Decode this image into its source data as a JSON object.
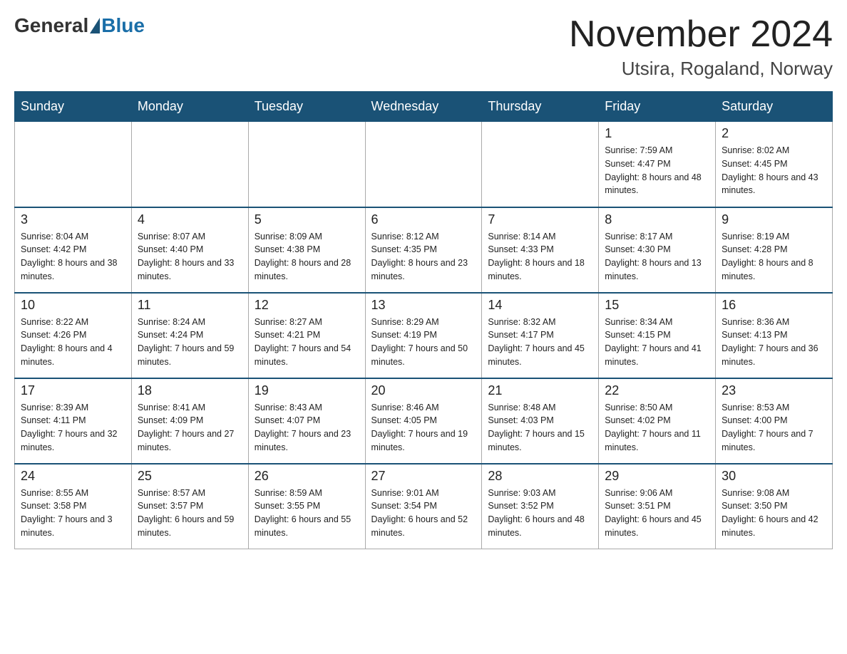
{
  "header": {
    "logo_general": "General",
    "logo_blue": "Blue",
    "month_title": "November 2024",
    "location": "Utsira, Rogaland, Norway"
  },
  "days_of_week": [
    "Sunday",
    "Monday",
    "Tuesday",
    "Wednesday",
    "Thursday",
    "Friday",
    "Saturday"
  ],
  "weeks": [
    [
      {
        "day": "",
        "info": ""
      },
      {
        "day": "",
        "info": ""
      },
      {
        "day": "",
        "info": ""
      },
      {
        "day": "",
        "info": ""
      },
      {
        "day": "",
        "info": ""
      },
      {
        "day": "1",
        "info": "Sunrise: 7:59 AM\nSunset: 4:47 PM\nDaylight: 8 hours and 48 minutes."
      },
      {
        "day": "2",
        "info": "Sunrise: 8:02 AM\nSunset: 4:45 PM\nDaylight: 8 hours and 43 minutes."
      }
    ],
    [
      {
        "day": "3",
        "info": "Sunrise: 8:04 AM\nSunset: 4:42 PM\nDaylight: 8 hours and 38 minutes."
      },
      {
        "day": "4",
        "info": "Sunrise: 8:07 AM\nSunset: 4:40 PM\nDaylight: 8 hours and 33 minutes."
      },
      {
        "day": "5",
        "info": "Sunrise: 8:09 AM\nSunset: 4:38 PM\nDaylight: 8 hours and 28 minutes."
      },
      {
        "day": "6",
        "info": "Sunrise: 8:12 AM\nSunset: 4:35 PM\nDaylight: 8 hours and 23 minutes."
      },
      {
        "day": "7",
        "info": "Sunrise: 8:14 AM\nSunset: 4:33 PM\nDaylight: 8 hours and 18 minutes."
      },
      {
        "day": "8",
        "info": "Sunrise: 8:17 AM\nSunset: 4:30 PM\nDaylight: 8 hours and 13 minutes."
      },
      {
        "day": "9",
        "info": "Sunrise: 8:19 AM\nSunset: 4:28 PM\nDaylight: 8 hours and 8 minutes."
      }
    ],
    [
      {
        "day": "10",
        "info": "Sunrise: 8:22 AM\nSunset: 4:26 PM\nDaylight: 8 hours and 4 minutes."
      },
      {
        "day": "11",
        "info": "Sunrise: 8:24 AM\nSunset: 4:24 PM\nDaylight: 7 hours and 59 minutes."
      },
      {
        "day": "12",
        "info": "Sunrise: 8:27 AM\nSunset: 4:21 PM\nDaylight: 7 hours and 54 minutes."
      },
      {
        "day": "13",
        "info": "Sunrise: 8:29 AM\nSunset: 4:19 PM\nDaylight: 7 hours and 50 minutes."
      },
      {
        "day": "14",
        "info": "Sunrise: 8:32 AM\nSunset: 4:17 PM\nDaylight: 7 hours and 45 minutes."
      },
      {
        "day": "15",
        "info": "Sunrise: 8:34 AM\nSunset: 4:15 PM\nDaylight: 7 hours and 41 minutes."
      },
      {
        "day": "16",
        "info": "Sunrise: 8:36 AM\nSunset: 4:13 PM\nDaylight: 7 hours and 36 minutes."
      }
    ],
    [
      {
        "day": "17",
        "info": "Sunrise: 8:39 AM\nSunset: 4:11 PM\nDaylight: 7 hours and 32 minutes."
      },
      {
        "day": "18",
        "info": "Sunrise: 8:41 AM\nSunset: 4:09 PM\nDaylight: 7 hours and 27 minutes."
      },
      {
        "day": "19",
        "info": "Sunrise: 8:43 AM\nSunset: 4:07 PM\nDaylight: 7 hours and 23 minutes."
      },
      {
        "day": "20",
        "info": "Sunrise: 8:46 AM\nSunset: 4:05 PM\nDaylight: 7 hours and 19 minutes."
      },
      {
        "day": "21",
        "info": "Sunrise: 8:48 AM\nSunset: 4:03 PM\nDaylight: 7 hours and 15 minutes."
      },
      {
        "day": "22",
        "info": "Sunrise: 8:50 AM\nSunset: 4:02 PM\nDaylight: 7 hours and 11 minutes."
      },
      {
        "day": "23",
        "info": "Sunrise: 8:53 AM\nSunset: 4:00 PM\nDaylight: 7 hours and 7 minutes."
      }
    ],
    [
      {
        "day": "24",
        "info": "Sunrise: 8:55 AM\nSunset: 3:58 PM\nDaylight: 7 hours and 3 minutes."
      },
      {
        "day": "25",
        "info": "Sunrise: 8:57 AM\nSunset: 3:57 PM\nDaylight: 6 hours and 59 minutes."
      },
      {
        "day": "26",
        "info": "Sunrise: 8:59 AM\nSunset: 3:55 PM\nDaylight: 6 hours and 55 minutes."
      },
      {
        "day": "27",
        "info": "Sunrise: 9:01 AM\nSunset: 3:54 PM\nDaylight: 6 hours and 52 minutes."
      },
      {
        "day": "28",
        "info": "Sunrise: 9:03 AM\nSunset: 3:52 PM\nDaylight: 6 hours and 48 minutes."
      },
      {
        "day": "29",
        "info": "Sunrise: 9:06 AM\nSunset: 3:51 PM\nDaylight: 6 hours and 45 minutes."
      },
      {
        "day": "30",
        "info": "Sunrise: 9:08 AM\nSunset: 3:50 PM\nDaylight: 6 hours and 42 minutes."
      }
    ]
  ]
}
